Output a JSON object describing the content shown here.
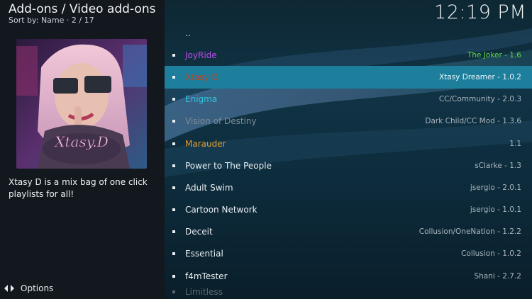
{
  "header": {
    "title": "Add-ons / Video add-ons",
    "subtitle": "Sort by: Name  ·  2 / 17",
    "clock": "12:19 PM"
  },
  "art": {
    "caption": "Xtasy.D"
  },
  "description": "Xtasy D is a mix bag of one click playlists for all!",
  "options_label": "Options",
  "list": {
    "parent": "..",
    "items": [
      {
        "name": "JoyRide",
        "meta": "The Joker - 1.6",
        "color": "#b84be8",
        "meta_color": "#5cd64a"
      },
      {
        "name": "Xtasy D",
        "meta": "Xtasy Dreamer - 1.0.2",
        "color": "#c0442a"
      },
      {
        "name": "Enigma",
        "meta": "CC/Community - 2.0.3",
        "color": "#2fc6e0"
      },
      {
        "name": "Vision of Destiny",
        "meta": "Dark Child/CC Mod - 1.3.6",
        "color": "#7d8b94"
      },
      {
        "name": "Marauder",
        "meta": "1.1",
        "color": "#e19a2c"
      },
      {
        "name": "Power to The People",
        "meta": "sClarke - 1.3",
        "color": "#e8eef2"
      },
      {
        "name": "Adult Swim",
        "meta": "jsergio - 2.0.1",
        "color": "#e8eef2"
      },
      {
        "name": "Cartoon Network",
        "meta": "jsergio - 1.0.1",
        "color": "#e8eef2"
      },
      {
        "name": "Deceit",
        "meta": "Collusion/OneNation - 1.2.2",
        "color": "#e8eef2"
      },
      {
        "name": "Essential",
        "meta": "Collusion - 1.0.2",
        "color": "#e8eef2"
      },
      {
        "name": "f4mTester",
        "meta": "Shani - 2.7.2",
        "color": "#e8eef2"
      },
      {
        "name": "Limitless",
        "meta": "",
        "color": "#e8eef2"
      }
    ]
  }
}
